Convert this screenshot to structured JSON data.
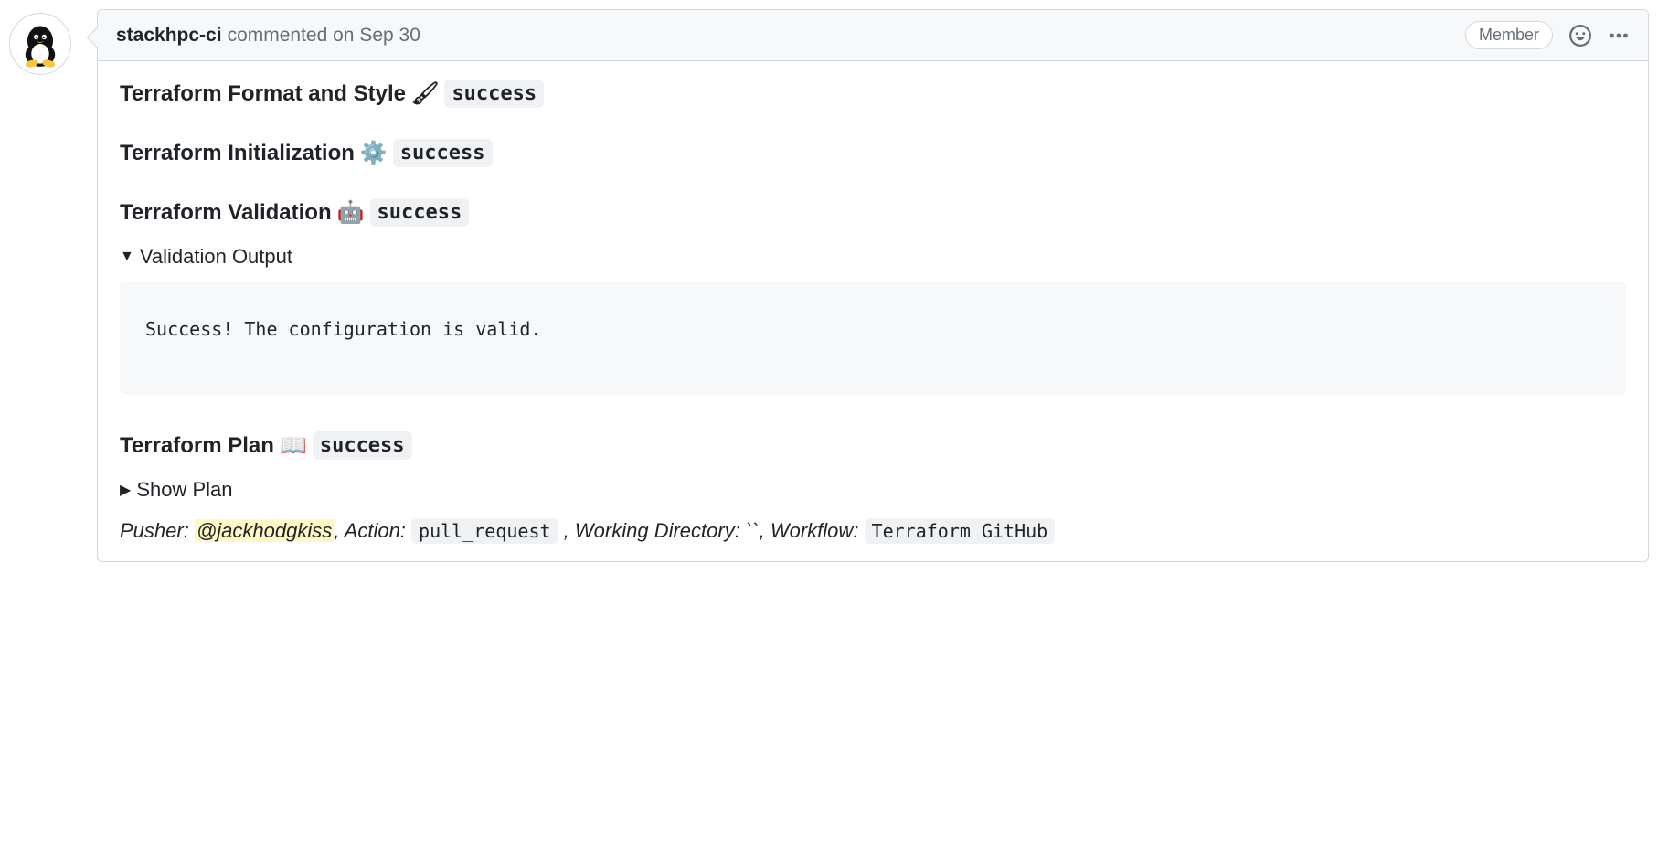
{
  "header": {
    "author": "stackhpc-ci",
    "action_text": "commented",
    "timestamp": "on Sep 30",
    "badge": "Member"
  },
  "statuses": {
    "format": {
      "title": "Terraform Format and Style",
      "emoji": "🖌",
      "status": "success"
    },
    "init": {
      "title": "Terraform Initialization",
      "emoji": "⚙️",
      "status": "success"
    },
    "validate": {
      "title": "Terraform Validation",
      "emoji": "🤖",
      "status": "success"
    },
    "plan": {
      "title": "Terraform Plan",
      "emoji": "📖",
      "status": "success"
    }
  },
  "validation": {
    "summary": "Validation Output",
    "output": "Success! The configuration is valid."
  },
  "plan_summary": "Show Plan",
  "meta": {
    "pusher_label": "Pusher:",
    "pusher_user": "@jackhodgkiss",
    "action_label": ", Action:",
    "action_value": "pull_request",
    "wd_label": ", Working Directory:",
    "wd_value": "``",
    "workflow_label": ", Workflow:",
    "workflow_value": "Terraform GitHub"
  }
}
